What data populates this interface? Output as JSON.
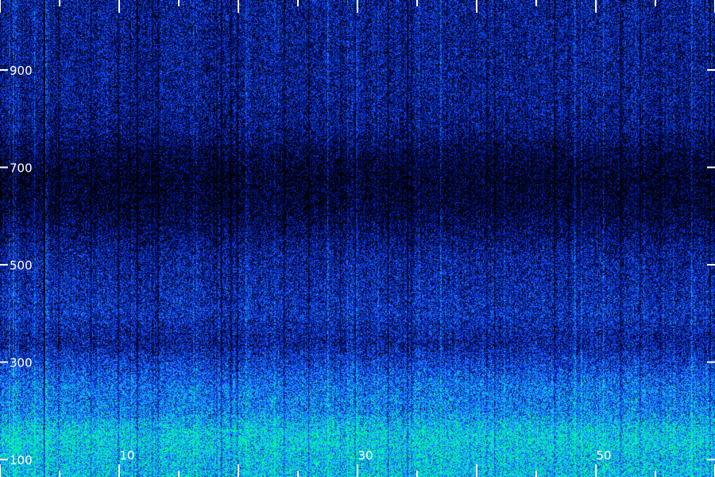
{
  "chart_data": {
    "type": "heatmap",
    "title": "",
    "xlabel": "",
    "ylabel": "",
    "x_ticks": [
      {
        "value": 10,
        "label": "10"
      },
      {
        "value": 30,
        "label": "30"
      },
      {
        "value": 50,
        "label": "50"
      }
    ],
    "y_ticks": [
      {
        "value": 100,
        "label": "100"
      },
      {
        "value": 300,
        "label": "300"
      },
      {
        "value": 500,
        "label": "500"
      },
      {
        "value": 700,
        "label": "700"
      },
      {
        "value": 900,
        "label": "900"
      }
    ],
    "xlim": [
      0,
      60
    ],
    "ylim": [
      100,
      1075
    ],
    "grid": false,
    "colormap": [
      "#000000",
      "#000a50",
      "#0a2ad2",
      "#1e64ff",
      "#14beff",
      "#00ff96"
    ],
    "intensity_profile": [
      {
        "y": 100,
        "level": 0.85
      },
      {
        "y": 130,
        "level": 0.9
      },
      {
        "y": 160,
        "level": 0.88
      },
      {
        "y": 200,
        "level": 0.7
      },
      {
        "y": 250,
        "level": 0.66
      },
      {
        "y": 300,
        "level": 0.5
      },
      {
        "y": 340,
        "level": 0.36
      },
      {
        "y": 400,
        "level": 0.45
      },
      {
        "y": 460,
        "level": 0.4
      },
      {
        "y": 520,
        "level": 0.36
      },
      {
        "y": 560,
        "level": 0.26
      },
      {
        "y": 620,
        "level": 0.14
      },
      {
        "y": 680,
        "level": 0.11
      },
      {
        "y": 720,
        "level": 0.16
      },
      {
        "y": 780,
        "level": 0.3
      },
      {
        "y": 850,
        "level": 0.34
      },
      {
        "y": 950,
        "level": 0.34
      },
      {
        "y": 1075,
        "level": 0.36
      }
    ]
  }
}
